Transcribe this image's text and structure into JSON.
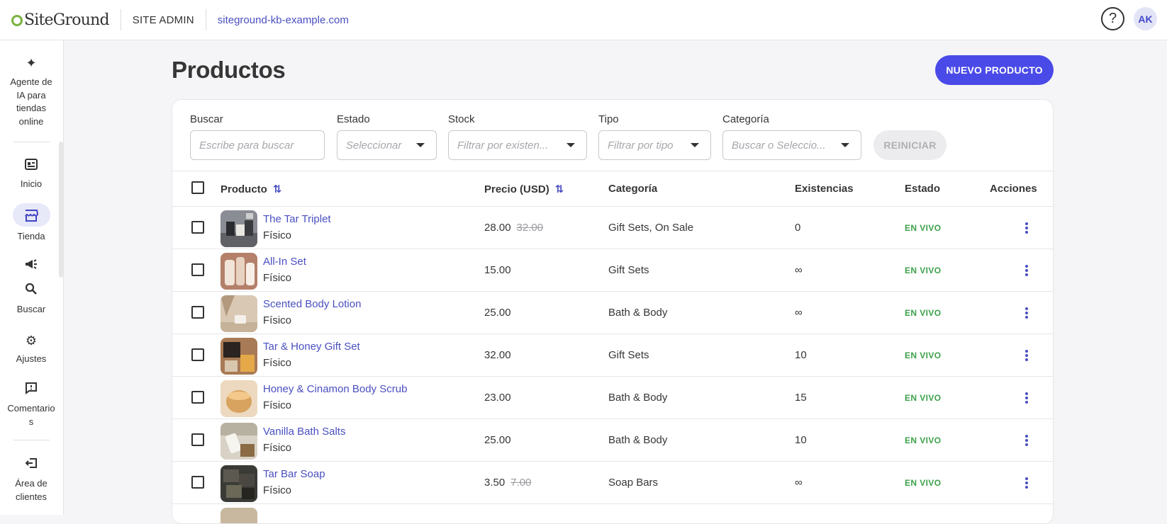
{
  "header": {
    "brand": "SiteGround",
    "section": "SITE ADMIN",
    "site": "siteground-kb-example.com",
    "help_icon": "help-icon",
    "avatar_initials": "AK"
  },
  "sidebar": {
    "items": [
      {
        "label": "Agente de IA para tiendas online",
        "icon": "sparkles-icon"
      },
      {
        "label": "Inicio",
        "icon": "dashboard-icon"
      },
      {
        "label": "Tienda",
        "icon": "store-icon"
      },
      {
        "label": "",
        "icon": "megaphone-icon"
      },
      {
        "label": "Buscar",
        "icon": "search-icon"
      },
      {
        "label": "Ajustes",
        "icon": "gear-icon"
      },
      {
        "label": "Comentarios",
        "icon": "feedback-icon"
      },
      {
        "label": "Área de clientes",
        "icon": "logout-icon"
      }
    ],
    "label_lines": {
      "ai_1": "Agente de",
      "ai_2": "IA para",
      "ai_3": "tiendas",
      "ai_4": "online",
      "comments_1": "Comentario",
      "comments_2": "s",
      "client_1": "Área de",
      "client_2": "clientes"
    }
  },
  "page": {
    "title": "Productos",
    "new_button": "NUEVO PRODUCTO"
  },
  "filters": {
    "search": {
      "label": "Buscar",
      "placeholder": "Escribe para buscar"
    },
    "status": {
      "label": "Estado",
      "placeholder": "Seleccionar"
    },
    "stock": {
      "label": "Stock",
      "placeholder": "Filtrar por existen..."
    },
    "type": {
      "label": "Tipo",
      "placeholder": "Filtrar por tipo"
    },
    "category": {
      "label": "Categoría",
      "placeholder": "Buscar o Seleccio..."
    },
    "reset": "REINICIAR"
  },
  "table": {
    "columns": {
      "product": "Producto",
      "price": "Precio (USD)",
      "category": "Categoría",
      "stock": "Existencias",
      "status": "Estado",
      "actions": "Acciones"
    },
    "rows": [
      {
        "name": "The Tar Triplet",
        "type": "Físico",
        "price": "28.00",
        "old_price": "32.00",
        "category": "Gift Sets, On Sale",
        "stock": "0",
        "status": "EN VIVO"
      },
      {
        "name": "All-In Set",
        "type": "Físico",
        "price": "15.00",
        "old_price": "",
        "category": "Gift Sets",
        "stock": "∞",
        "status": "EN VIVO"
      },
      {
        "name": "Scented Body Lotion",
        "type": "Físico",
        "price": "25.00",
        "old_price": "",
        "category": "Bath & Body",
        "stock": "∞",
        "status": "EN VIVO"
      },
      {
        "name": "Tar & Honey Gift Set",
        "type": "Físico",
        "price": "32.00",
        "old_price": "",
        "category": "Gift Sets",
        "stock": "10",
        "status": "EN VIVO"
      },
      {
        "name": "Honey & Cinamon Body Scrub",
        "type": "Físico",
        "price": "23.00",
        "old_price": "",
        "category": "Bath & Body",
        "stock": "15",
        "status": "EN VIVO"
      },
      {
        "name": "Vanilla Bath Salts",
        "type": "Físico",
        "price": "25.00",
        "old_price": "",
        "category": "Bath & Body",
        "stock": "10",
        "status": "EN VIVO"
      },
      {
        "name": "Tar Bar Soap",
        "type": "Físico",
        "price": "3.50",
        "old_price": "7.00",
        "category": "Soap Bars",
        "stock": "∞",
        "status": "EN VIVO"
      }
    ]
  },
  "colors": {
    "accent": "#4a4ae8",
    "link": "#4a4fc0",
    "live": "#3da14b"
  }
}
